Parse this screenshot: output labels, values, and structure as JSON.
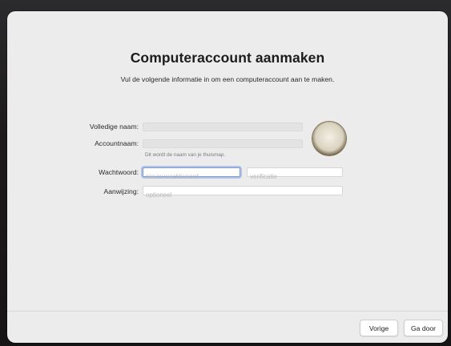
{
  "setup": {
    "title": "Computeraccount aanmaken",
    "subtitle": "Vul de volgende informatie in om een computeraccount aan te maken."
  },
  "form": {
    "full_name": {
      "label": "Volledige naam:",
      "value": ""
    },
    "account_name": {
      "label": "Accountnaam:",
      "value": "",
      "hint": "Dit wordt de naam van je thuismap."
    },
    "password": {
      "label": "Wachtwoord:",
      "placeholder": "nieuw wachtwoord",
      "verify_placeholder": "verificatie"
    },
    "hint_field": {
      "label": "Aanwijzing:",
      "placeholder": "optioneel"
    }
  },
  "footer": {
    "back_label": "Vorige",
    "continue_label": "Ga door"
  }
}
